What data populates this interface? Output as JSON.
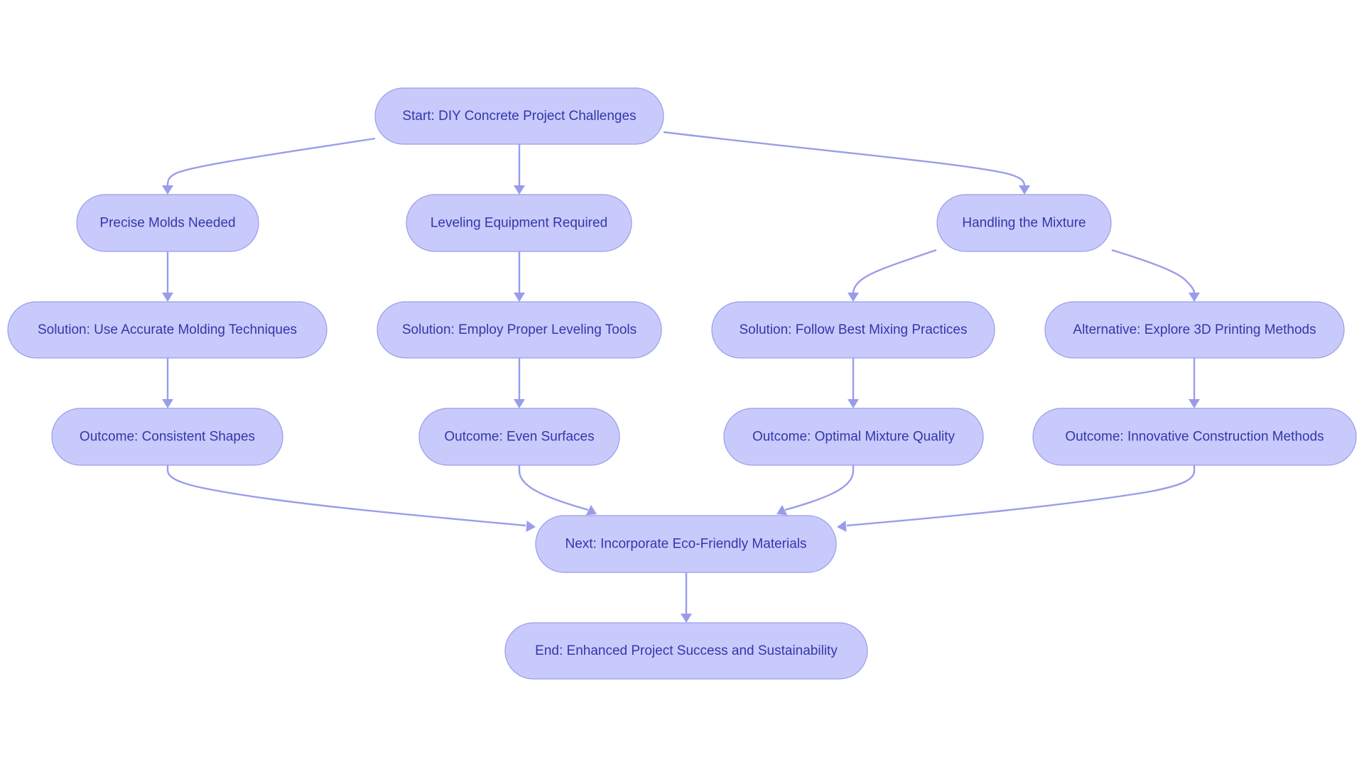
{
  "diagram": {
    "type": "flowchart",
    "direction": "top-down",
    "colors": {
      "node_fill": "#C8CAFC",
      "node_border": "#9A9CE8",
      "node_text": "#3436A8",
      "edge": "#9A9CEA",
      "background": "#FFFFFF"
    },
    "nodes": [
      {
        "id": "start",
        "label": "Start: DIY Concrete Project Challenges"
      },
      {
        "id": "molds",
        "label": "Precise Molds Needed"
      },
      {
        "id": "leveling",
        "label": "Leveling Equipment Required"
      },
      {
        "id": "mixture",
        "label": "Handling the Mixture"
      },
      {
        "id": "sol_molding",
        "label": "Solution: Use Accurate Molding Techniques"
      },
      {
        "id": "sol_leveling",
        "label": "Solution: Employ Proper Leveling Tools"
      },
      {
        "id": "sol_mixing",
        "label": "Solution: Follow Best Mixing Practices"
      },
      {
        "id": "alt_3d",
        "label": "Alternative: Explore 3D Printing Methods"
      },
      {
        "id": "out_shapes",
        "label": "Outcome: Consistent Shapes"
      },
      {
        "id": "out_surfaces",
        "label": "Outcome: Even Surfaces"
      },
      {
        "id": "out_mixture",
        "label": "Outcome: Optimal Mixture Quality"
      },
      {
        "id": "out_innovative",
        "label": "Outcome: Innovative Construction Methods"
      },
      {
        "id": "next",
        "label": "Next: Incorporate Eco-Friendly Materials"
      },
      {
        "id": "end",
        "label": "End: Enhanced Project Success and Sustainability"
      }
    ],
    "edges": [
      {
        "from": "start",
        "to": "molds"
      },
      {
        "from": "start",
        "to": "leveling"
      },
      {
        "from": "start",
        "to": "mixture"
      },
      {
        "from": "molds",
        "to": "sol_molding"
      },
      {
        "from": "leveling",
        "to": "sol_leveling"
      },
      {
        "from": "mixture",
        "to": "sol_mixing"
      },
      {
        "from": "mixture",
        "to": "alt_3d"
      },
      {
        "from": "sol_molding",
        "to": "out_shapes"
      },
      {
        "from": "sol_leveling",
        "to": "out_surfaces"
      },
      {
        "from": "sol_mixing",
        "to": "out_mixture"
      },
      {
        "from": "alt_3d",
        "to": "out_innovative"
      },
      {
        "from": "out_shapes",
        "to": "next"
      },
      {
        "from": "out_surfaces",
        "to": "next"
      },
      {
        "from": "out_mixture",
        "to": "next"
      },
      {
        "from": "out_innovative",
        "to": "next"
      },
      {
        "from": "next",
        "to": "end"
      }
    ]
  }
}
